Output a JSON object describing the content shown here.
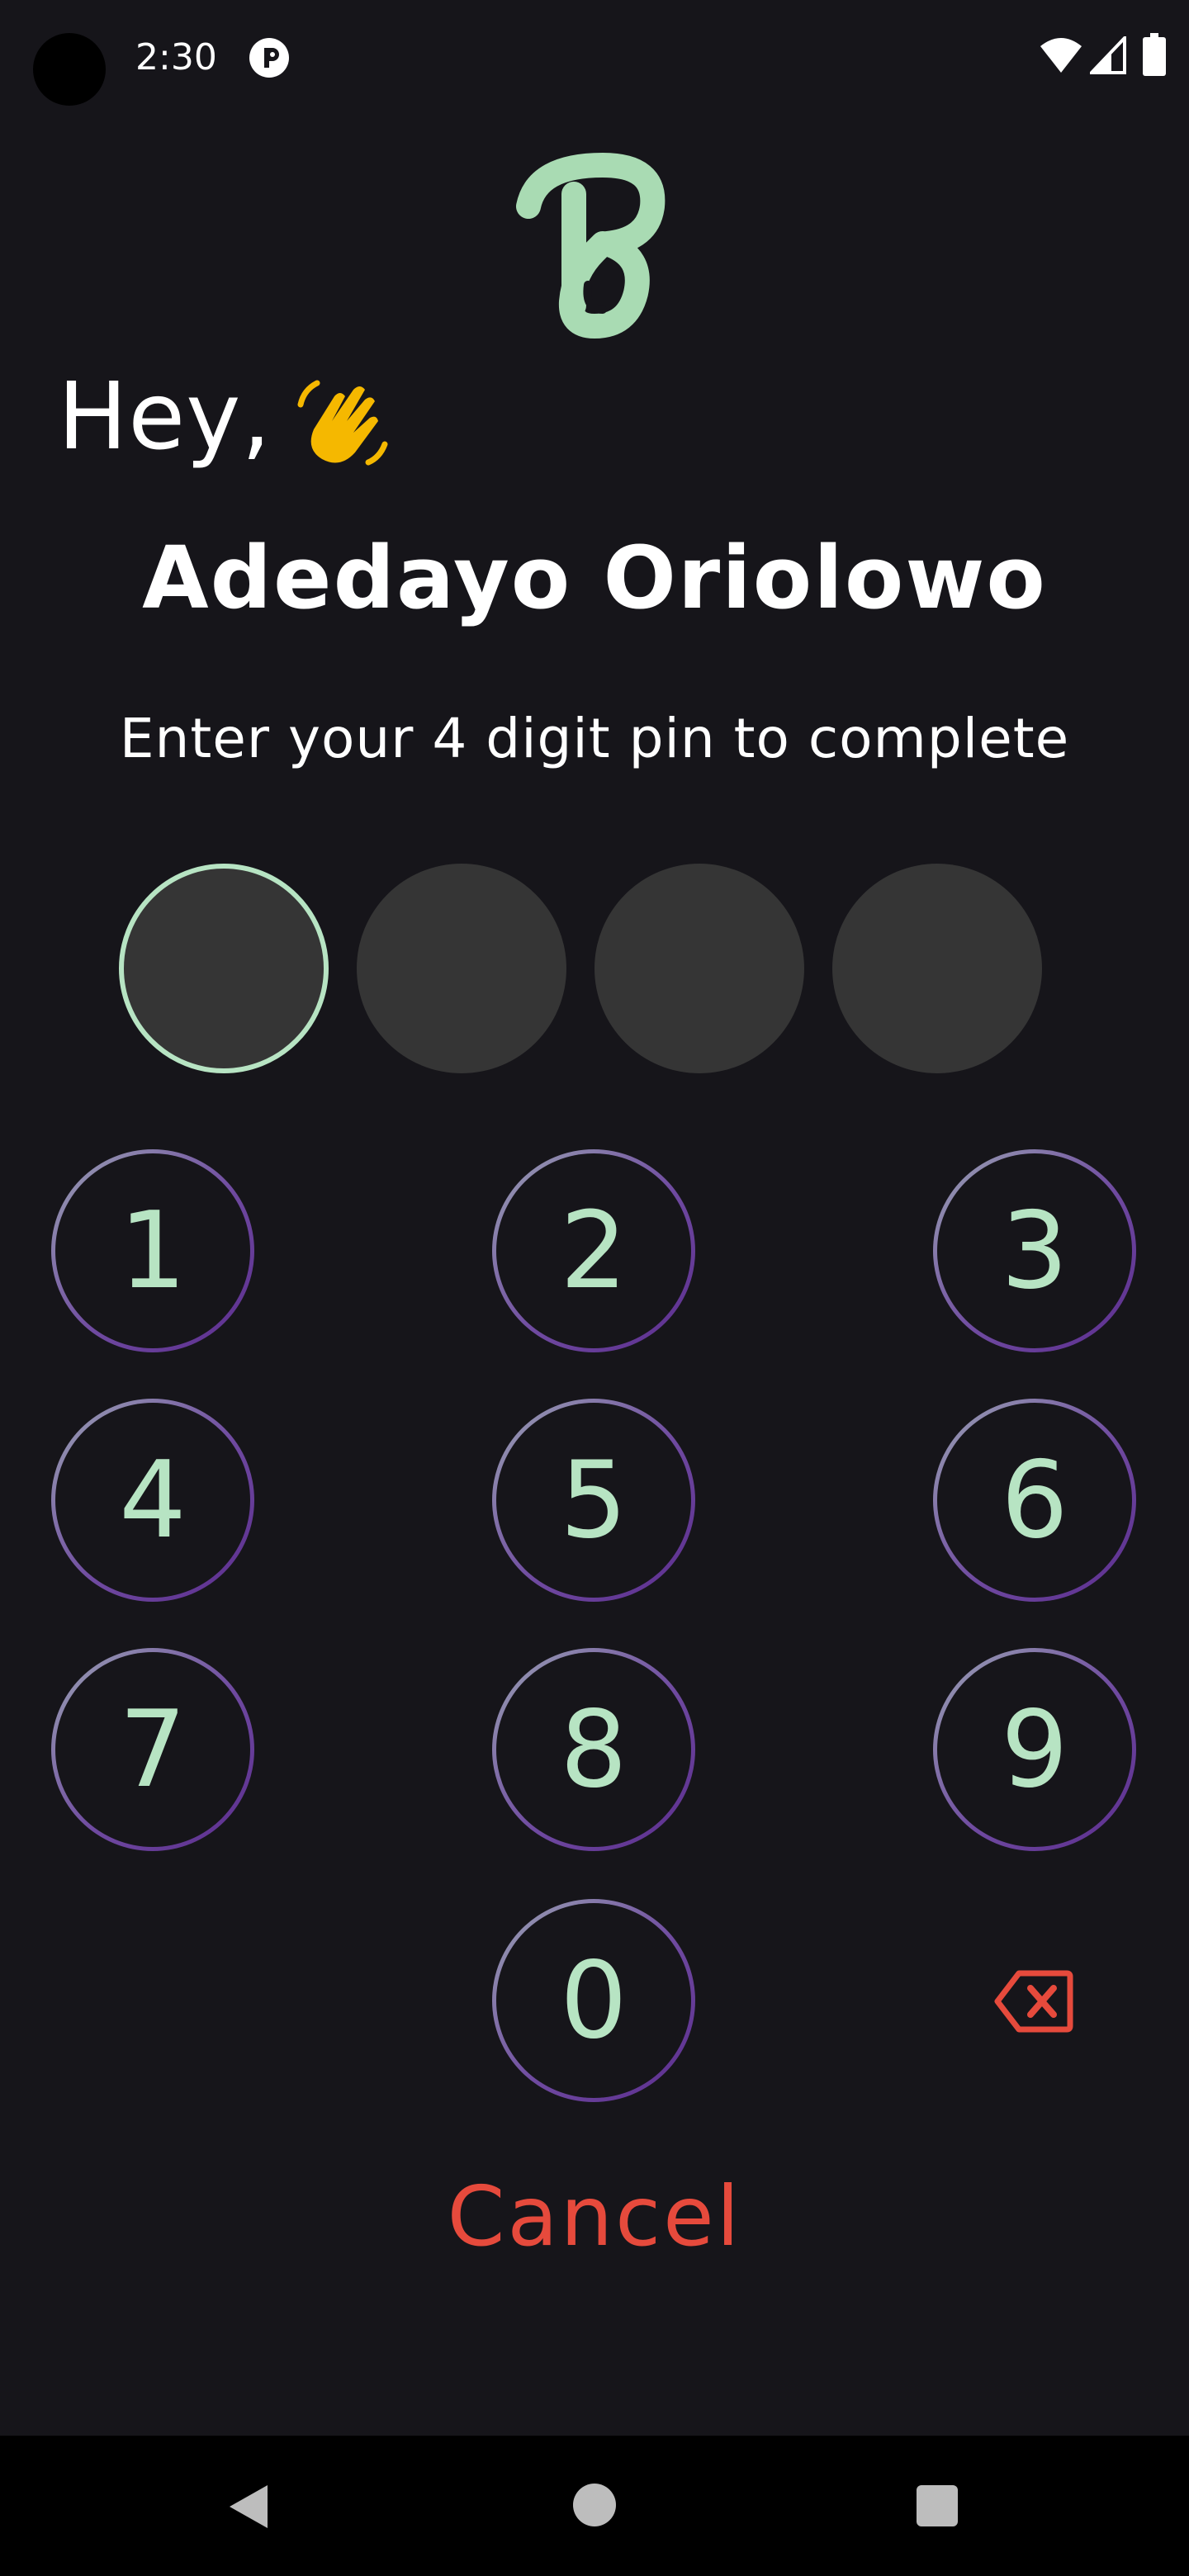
{
  "status_bar": {
    "time": "2:30",
    "icons": [
      "camera-cutout",
      "app-notification-icon",
      "wifi-icon",
      "signal-icon",
      "battery-icon"
    ]
  },
  "logo": {
    "icon": "brand-logo-b",
    "color": "#a9dbb3"
  },
  "greeting": {
    "text": "Hey,",
    "emoji": "waving-hand"
  },
  "user": {
    "name": "Adedayo Oriolowo"
  },
  "instruction": "Enter your 4 digit pin to complete",
  "pin": {
    "length": 4,
    "entered": 0
  },
  "keypad": {
    "keys": [
      "1",
      "2",
      "3",
      "4",
      "5",
      "6",
      "7",
      "8",
      "9",
      "0"
    ],
    "backspace_icon": "backspace-icon"
  },
  "cancel_label": "Cancel",
  "colors": {
    "background": "#16151a",
    "accent_green": "#b7e4c3",
    "pin_slot": "#353535",
    "cancel_red": "#e64a3c",
    "key_ring_start": "#9aa3b3",
    "key_ring_end": "#5b2c8e"
  },
  "nav_bar": {
    "icons": [
      "back-icon",
      "home-icon",
      "recents-icon"
    ]
  }
}
